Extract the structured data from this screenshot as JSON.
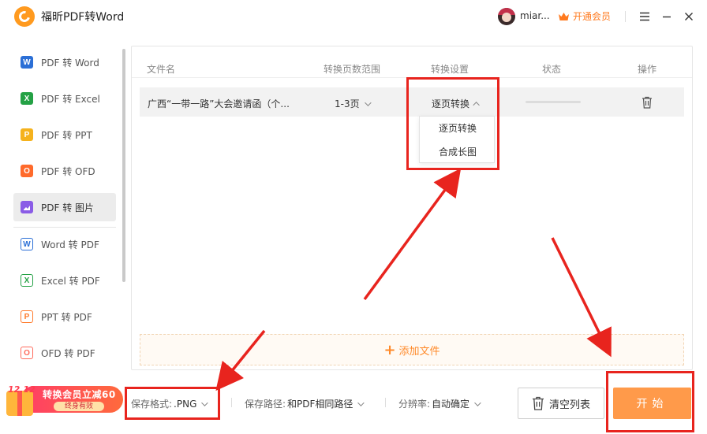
{
  "app": {
    "title": "福昕PDF转Word",
    "username": "miar...",
    "vip_label": "开通会员"
  },
  "sidebar": {
    "items": [
      {
        "label": "PDF 转 Word",
        "icon": "word-icon",
        "letter": "W",
        "color": "#2b6fd6",
        "active": false
      },
      {
        "label": "PDF 转 Excel",
        "icon": "excel-icon",
        "letter": "X",
        "color": "#24a145",
        "active": false
      },
      {
        "label": "PDF 转 PPT",
        "icon": "ppt-icon",
        "letter": "P",
        "color": "#f5b21d",
        "active": false
      },
      {
        "label": "PDF 转 OFD",
        "icon": "ofd-icon",
        "letter": "O",
        "color": "#ff6a2b",
        "active": false
      },
      {
        "label": "PDF 转 图片",
        "icon": "image-icon",
        "letter": "",
        "color": "#8a5ce6",
        "active": true
      },
      {
        "label": "Word 转 PDF",
        "icon": "word-outline-icon",
        "letter": "W",
        "color": "#2b6fd6",
        "active": false
      },
      {
        "label": "Excel 转 PDF",
        "icon": "excel-outline-icon",
        "letter": "X",
        "color": "#24a145",
        "active": false
      },
      {
        "label": "PPT 转 PDF",
        "icon": "ppt-outline-icon",
        "letter": "P",
        "color": "#ff7a2b",
        "active": false
      },
      {
        "label": "OFD 转 PDF",
        "icon": "ofd-outline-icon",
        "letter": "O",
        "color": "#ff6a5b",
        "active": false
      }
    ]
  },
  "table": {
    "headers": {
      "filename": "文件名",
      "page_range": "转换页数范围",
      "settings": "转换设置",
      "status": "状态",
      "actions": "操作"
    },
    "rows": [
      {
        "filename": "广西“一带一路”大会邀请函（个...",
        "page_range": "1-3页",
        "setting": "逐页转换",
        "progress": 0
      }
    ],
    "dropdown_options": [
      "逐页转换",
      "合成长图"
    ],
    "add_file_label": "添加文件"
  },
  "promo": {
    "date": "12.12",
    "title": "转换会员立减60",
    "subtitle": "终身有效"
  },
  "bottom": {
    "format_label": "保存格式:",
    "format_value": ".PNG",
    "path_label": "保存路径:",
    "path_value": "和PDF相同路径",
    "resolution_label": "分辨率:",
    "resolution_value": "自动确定",
    "clear_label": "清空列表",
    "start_label": "开始"
  },
  "colors": {
    "accent": "#ff9a4a",
    "annotation": "#e8241e"
  }
}
